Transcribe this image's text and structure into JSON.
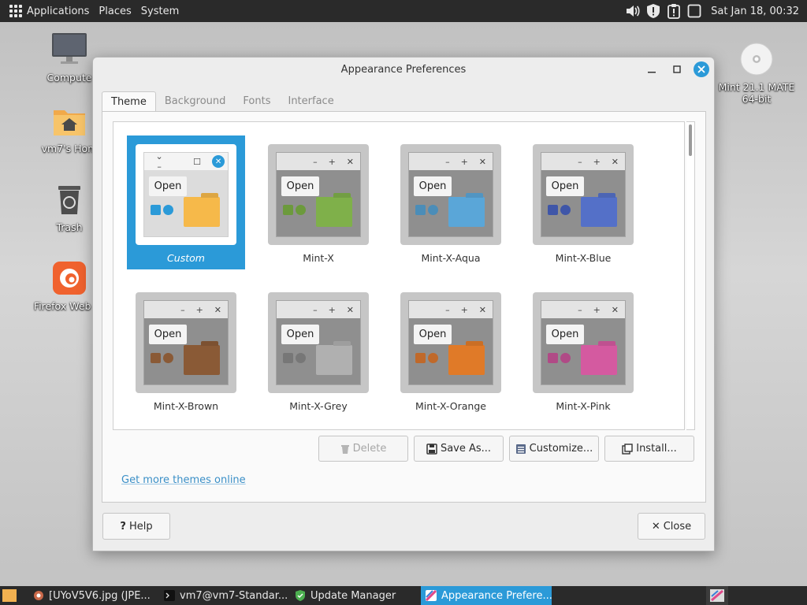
{
  "top_panel": {
    "menus": [
      "Applications",
      "Places",
      "System"
    ],
    "clock": "Sat Jan 18, 00:32",
    "tray_icons": [
      "volume-icon",
      "shield-alert-icon",
      "clipboard-alert-icon",
      "workspace-icon"
    ]
  },
  "desktop_icons": [
    {
      "label": "Compute",
      "icon": "computer-icon"
    },
    {
      "label": "vm7's Hom",
      "icon": "home-folder-icon"
    },
    {
      "label": "Trash",
      "icon": "trash-icon"
    },
    {
      "label": "Firefox Web Br",
      "icon": "firefox-icon"
    },
    {
      "label": "Mint 21.1 MATE 64-bit",
      "icon": "disc-icon"
    }
  ],
  "window": {
    "title": "Appearance Preferences",
    "tabs": [
      "Theme",
      "Background",
      "Fonts",
      "Interface"
    ],
    "active_tab": "Theme",
    "themes": [
      {
        "name": "Custom",
        "folder_color": "#f6b94a",
        "chk1": "#2b9ad8",
        "chk2": "#2b9ad8",
        "selected": true
      },
      {
        "name": "Mint-X",
        "folder_color": "#7fb04a",
        "chk1": "#6c9a3c",
        "chk2": "#6c9a3c"
      },
      {
        "name": "Mint-X-Aqua",
        "folder_color": "#5aa6d8",
        "chk1": "#4b8db8",
        "chk2": "#4b8db8"
      },
      {
        "name": "Mint-X-Blue",
        "folder_color": "#5470c8",
        "chk1": "#3f56a8",
        "chk2": "#3f56a8"
      },
      {
        "name": "Mint-X-Brown",
        "folder_color": "#8a5a36",
        "chk1": "#8a5a36",
        "chk2": "#8a5a36"
      },
      {
        "name": "Mint-X-Grey",
        "folder_color": "#b0b0b0",
        "chk1": "#777777",
        "chk2": "#777777"
      },
      {
        "name": "Mint-X-Orange",
        "folder_color": "#e07a28",
        "chk1": "#c0692a",
        "chk2": "#c0692a"
      },
      {
        "name": "Mint-X-Pink",
        "folder_color": "#d45aa0",
        "chk1": "#b04a86",
        "chk2": "#b04a86"
      }
    ],
    "mini_open_label": "Open",
    "buttons": {
      "delete": "Delete",
      "save_as": "Save As...",
      "customize": "Customize...",
      "install": "Install..."
    },
    "link": "Get more themes online",
    "help": "Help",
    "close": "Close"
  },
  "taskbar": {
    "tasks": [
      {
        "label": "[UYoV5V6.jpg (JPE...",
        "icon": "image-viewer-icon"
      },
      {
        "label": "vm7@vm7-Standar...",
        "icon": "terminal-icon"
      },
      {
        "label": "Update Manager",
        "icon": "update-shield-icon"
      },
      {
        "label": "Appearance Prefere...",
        "icon": "appearance-icon",
        "active": true
      }
    ]
  },
  "colors": {
    "accent": "#2b9ad8",
    "panel": "#2a2a2a",
    "link": "#3a8fc7"
  }
}
